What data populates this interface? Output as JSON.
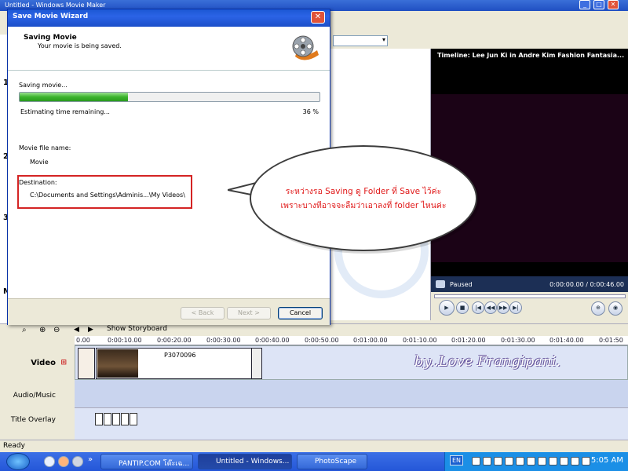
{
  "background_app": {
    "title": "Untitled - Windows Movie Maker",
    "controls": {
      "minimize": "_",
      "maximize": "□",
      "close": "✕"
    },
    "storyboard_label": "Show Storyboard",
    "left_strip_numbers": [
      "1",
      "2",
      "3",
      "M"
    ],
    "preview": {
      "title": "Timeline: Lee Jun Ki in Andre Kim Fashion Fantasia...",
      "status": "Paused",
      "time": "0:00:00.00 / 0:00:46.00"
    },
    "timeline": {
      "ticks": [
        "0.00",
        "0:00:10.00",
        "0:00:20.00",
        "0:00:30.00",
        "0:00:40.00",
        "0:00:50.00",
        "0:01:00.00",
        "0:01:10.00",
        "0:01:20.00",
        "0:01:30.00",
        "0:01:40.00",
        "0:01:50"
      ],
      "tracks": {
        "video": "Video",
        "audio": "Audio/Music",
        "title_overlay": "Title Overlay"
      },
      "clip_name": "P3070096"
    },
    "status": "Ready"
  },
  "dialog": {
    "title": "Save Movie Wizard",
    "close": "✕",
    "header_title": "Saving Movie",
    "header_subtitle": "Your movie is being saved.",
    "saving_label": "Saving movie...",
    "progress_value": 36,
    "estimating": "Estimating time remaining...",
    "percent_text": "36 %",
    "file_name_label": "Movie file name:",
    "file_name": "Movie",
    "destination_label": "Destination:",
    "destination": "C:\\Documents and Settings\\Adminis...\\My Videos\\",
    "buttons": {
      "back": "< Back",
      "next": "Next >",
      "cancel": "Cancel"
    }
  },
  "annotation": {
    "line1": "ระหว่างรอ Saving ดู Folder ที่ Save ไว้ค่ะ",
    "line2": "เพราะบางทีอาจจะลืมว่าเอาลงที่ folder ไหนค่ะ",
    "watermark": "by..Love Frangipani.",
    "accent_color": "#e01818"
  },
  "taskbar": {
    "items": [
      "PANTIP.COM โต๊ะเฉ...",
      "Untitled - Windows...",
      "PhotoScape"
    ],
    "active_index": 1,
    "language": "EN",
    "clock": "5:05 AM"
  }
}
